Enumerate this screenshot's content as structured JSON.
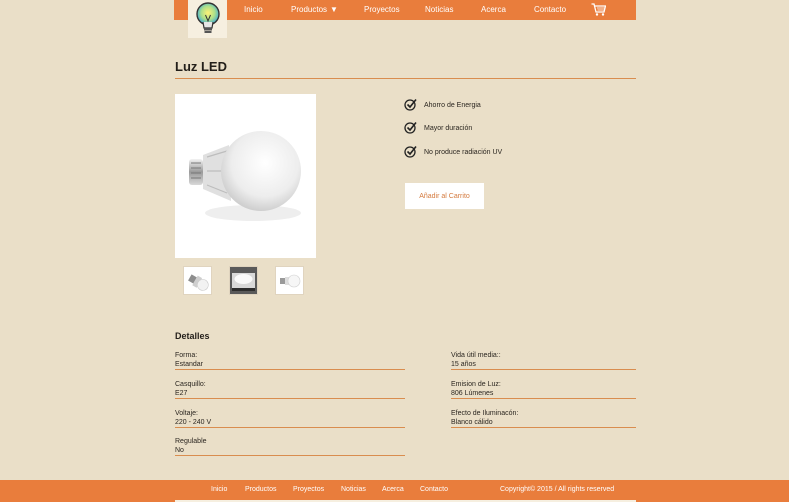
{
  "nav": {
    "items": [
      "Inicio",
      "Productos",
      "Proyectos",
      "Noticias",
      "Acerca",
      "Contacto"
    ],
    "caret": "▼",
    "brand_color": "#e97d3c"
  },
  "product": {
    "title": "Luz LED",
    "features": [
      "Ahorro de Energia",
      "Mayor duración",
      "No produce radiación UV"
    ],
    "cart_button": "Añadir al Carrito"
  },
  "details": {
    "heading": "Detalles",
    "left": [
      {
        "label": "Forma:",
        "value": "Estandar"
      },
      {
        "label": "Casquillo:",
        "value": "E27"
      },
      {
        "label": "Voltaje:",
        "value": "220 - 240 V"
      },
      {
        "label": "Regulable",
        "value": "No"
      }
    ],
    "right": [
      {
        "label": "Vida útil media::",
        "value": "15 años"
      },
      {
        "label": "Emision de Luz:",
        "value": "806 Lúmenes"
      },
      {
        "label": "Efecto de Iluminacón:",
        "value": "Blanco cálido"
      }
    ]
  },
  "footer": {
    "items": [
      "Inicio",
      "Productos",
      "Proyectos",
      "Noticias",
      "Acerca",
      "Contacto"
    ],
    "copyright": "Copyright© 2015 / All rights reserved"
  },
  "icons": {
    "logo": "lightbulb-icon",
    "cart": "shopping-cart-icon",
    "feature_check": "check-icon"
  }
}
